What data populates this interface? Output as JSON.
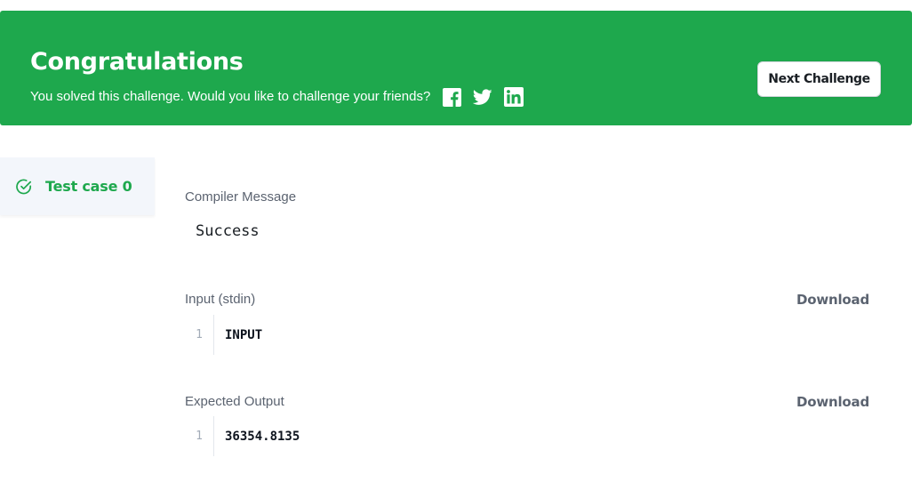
{
  "banner": {
    "title": "Congratulations",
    "subtitle": "You solved this challenge. Would you like to challenge your friends?",
    "social_icons": [
      "facebook-icon",
      "twitter-icon",
      "linkedin-icon"
    ],
    "background_color": "#1ea84d",
    "next_button_label": "Next Challenge"
  },
  "sidebar": {
    "tabs": [
      {
        "label": "Test case 0",
        "icon": "check-circle-icon",
        "status_color": "#1ea84d"
      }
    ]
  },
  "result": {
    "compiler_message_label": "Compiler Message",
    "compiler_message": "Success",
    "input_label": "Input (stdin)",
    "input_download_label": "Download",
    "input_lines": [
      {
        "number": "1",
        "text": "INPUT"
      }
    ],
    "expected_label": "Expected Output",
    "expected_download_label": "Download",
    "expected_lines": [
      {
        "number": "1",
        "text": "36354.8135"
      }
    ]
  }
}
